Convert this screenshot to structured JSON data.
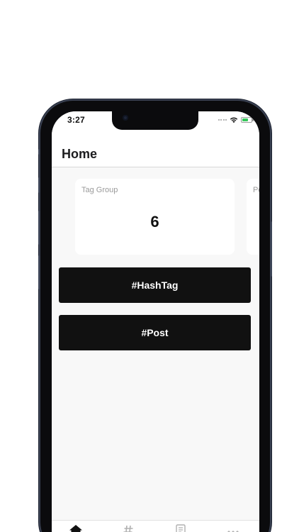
{
  "status_bar": {
    "time": "3:27"
  },
  "header": {
    "title": "Home"
  },
  "stats": [
    {
      "label": "Tag Group",
      "value": "6"
    },
    {
      "label": "Po",
      "value": ""
    }
  ],
  "actions": {
    "hashtag_label": "#HashTag",
    "post_label": "#Post"
  },
  "tab_bar": {
    "items": [
      {
        "icon": "home-icon",
        "active": true
      },
      {
        "icon": "hashtag-icon",
        "active": false
      },
      {
        "icon": "document-icon",
        "active": false
      },
      {
        "icon": "more-icon",
        "active": false
      }
    ]
  },
  "colors": {
    "accent": "#111111",
    "background": "#f8f8f8",
    "battery": "#34c759",
    "muted_text": "#9a9a9a"
  }
}
